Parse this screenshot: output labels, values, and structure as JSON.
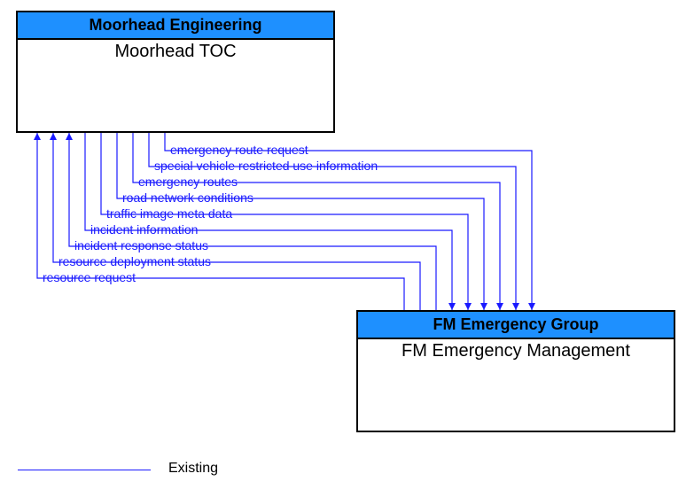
{
  "top_box": {
    "header": "Moorhead Engineering",
    "title": "Moorhead TOC"
  },
  "bottom_box": {
    "header": "FM Emergency Group",
    "title": "FM Emergency Management"
  },
  "flows": [
    {
      "label": "emergency route request"
    },
    {
      "label": "special vehicle restricted use information"
    },
    {
      "label": "emergency routes"
    },
    {
      "label": "road network conditions"
    },
    {
      "label": "traffic image meta data"
    },
    {
      "label": "incident information"
    },
    {
      "label": "incident response status"
    },
    {
      "label": "resource deployment status"
    },
    {
      "label": "resource request"
    }
  ],
  "legend": {
    "label": "Existing"
  },
  "chart_data": {
    "type": "table",
    "title": "Information flows between Moorhead TOC and FM Emergency Management",
    "nodes": [
      {
        "id": "moorhead_toc",
        "label": "Moorhead TOC",
        "group": "Moorhead Engineering"
      },
      {
        "id": "fm_emergency_mgmt",
        "label": "FM Emergency Management",
        "group": "FM Emergency Group"
      }
    ],
    "edges": [
      {
        "from": "moorhead_toc",
        "to": "fm_emergency_mgmt",
        "label": "emergency route request",
        "status": "Existing"
      },
      {
        "from": "moorhead_toc",
        "to": "fm_emergency_mgmt",
        "label": "special vehicle restricted use information",
        "status": "Existing"
      },
      {
        "from": "moorhead_toc",
        "to": "fm_emergency_mgmt",
        "label": "emergency routes",
        "status": "Existing"
      },
      {
        "from": "moorhead_toc",
        "to": "fm_emergency_mgmt",
        "label": "road network conditions",
        "status": "Existing"
      },
      {
        "from": "moorhead_toc",
        "to": "fm_emergency_mgmt",
        "label": "traffic image meta data",
        "status": "Existing"
      },
      {
        "from": "moorhead_toc",
        "to": "fm_emergency_mgmt",
        "label": "incident information",
        "status": "Existing"
      },
      {
        "from": "fm_emergency_mgmt",
        "to": "moorhead_toc",
        "label": "incident response status",
        "status": "Existing"
      },
      {
        "from": "fm_emergency_mgmt",
        "to": "moorhead_toc",
        "label": "resource deployment status",
        "status": "Existing"
      },
      {
        "from": "fm_emergency_mgmt",
        "to": "moorhead_toc",
        "label": "resource request",
        "status": "Existing"
      }
    ]
  }
}
